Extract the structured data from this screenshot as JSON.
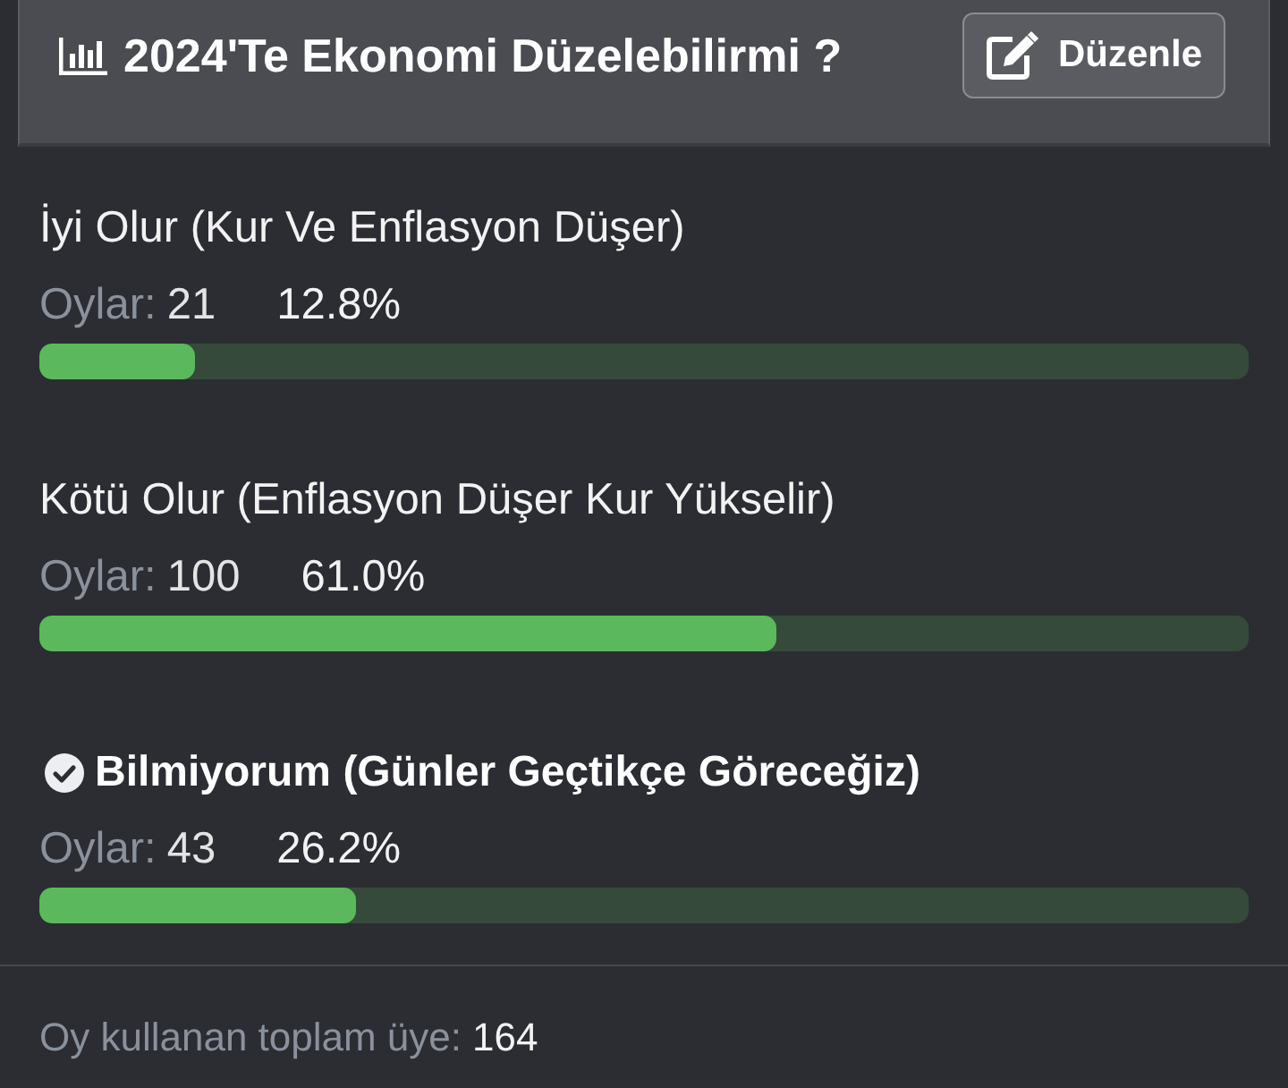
{
  "poll": {
    "title": "2024'Te Ekonomi Düzelebilirmi ?",
    "edit_button": "Düzenle"
  },
  "options": [
    {
      "label": "İyi Olur (Kur Ve Enflasyon Düşer)",
      "votes_label": "Oylar:",
      "votes": "21",
      "percent": "12.8%",
      "level": 0.128,
      "selected": false
    },
    {
      "label": "Kötü Olur (Enflasyon Düşer Kur Yükselir)",
      "votes_label": "Oylar:",
      "votes": "100",
      "percent": "61.0%",
      "level": 0.61,
      "selected": false
    },
    {
      "label": "Bilmiyorum (Günler Geçtikçe Göreceğiz)",
      "votes_label": "Oylar:",
      "votes": "43",
      "percent": "26.2%",
      "level": 0.262,
      "selected": true
    }
  ],
  "footer": {
    "label": "Oy kullanan toplam üye:",
    "total": "164"
  }
}
